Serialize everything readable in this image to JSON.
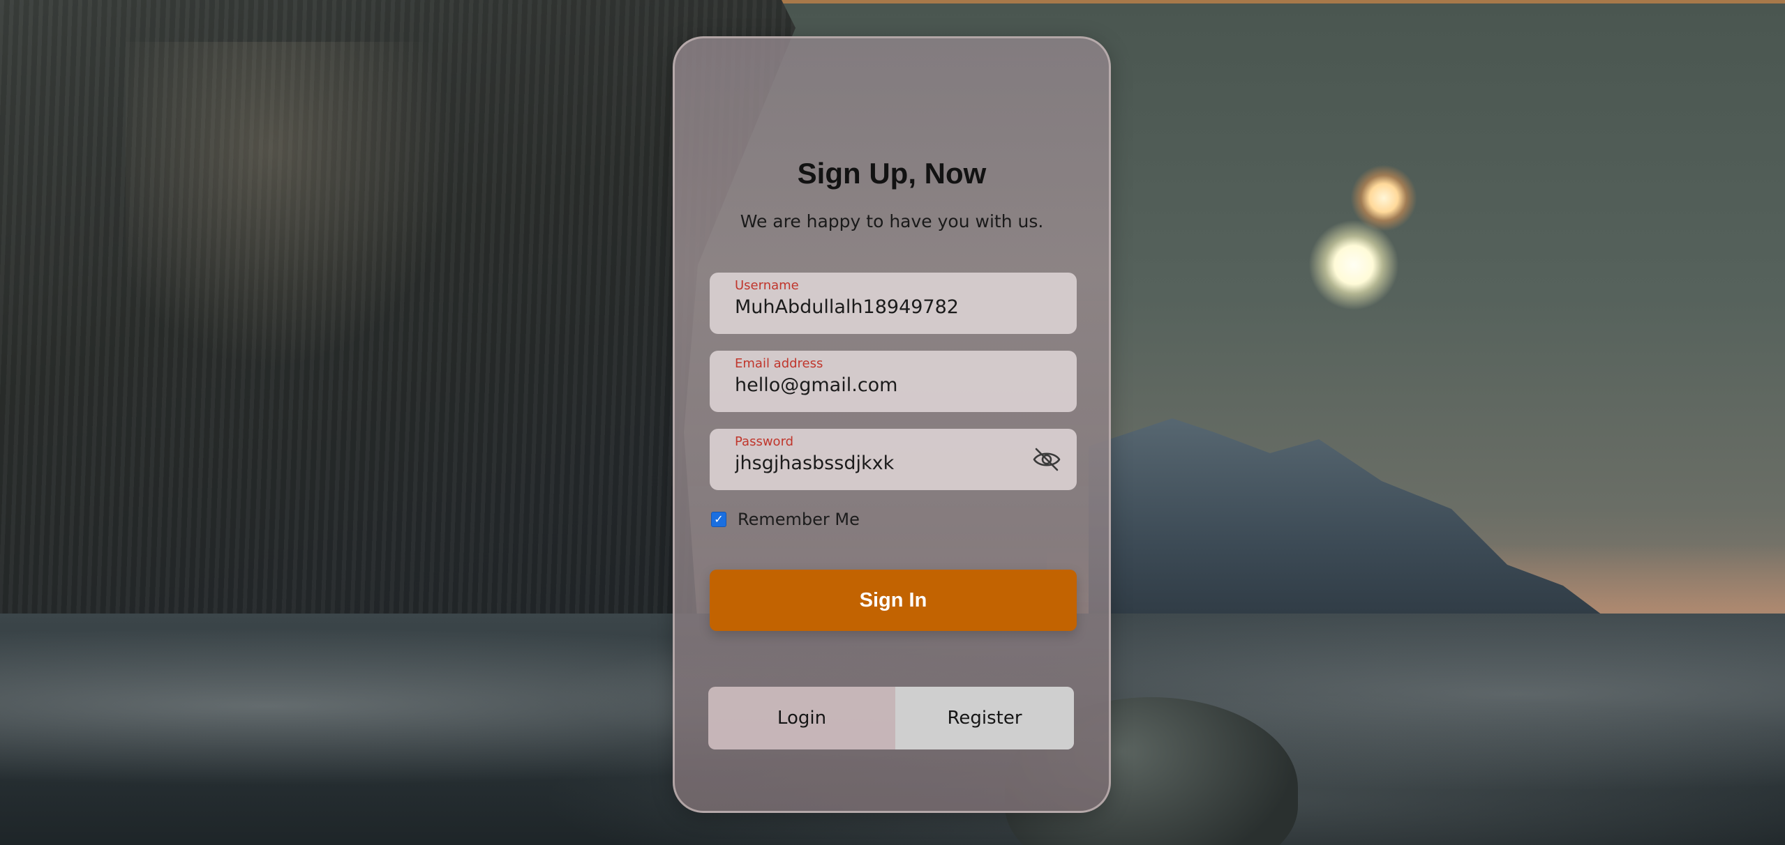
{
  "form": {
    "title": "Sign Up, Now",
    "subtitle": "We are happy to have you with us.",
    "username": {
      "label": "Username",
      "value": "MuhAbdullalh18949782"
    },
    "email": {
      "label": "Email address",
      "value": "hello@gmail.com"
    },
    "password": {
      "label": "Password",
      "value": "jhsgjhasbssdjkxk",
      "visibility_icon": "eye-slash-icon"
    },
    "remember": {
      "label": "Remember Me",
      "checked": true
    },
    "submit_label": "Sign In"
  },
  "switcher": {
    "tabs": [
      {
        "label": "Login",
        "active": false
      },
      {
        "label": "Register",
        "active": true
      }
    ]
  },
  "colors": {
    "accent": "#c26301",
    "field_label": "#c0362c",
    "checkbox": "#1a6fe0"
  }
}
